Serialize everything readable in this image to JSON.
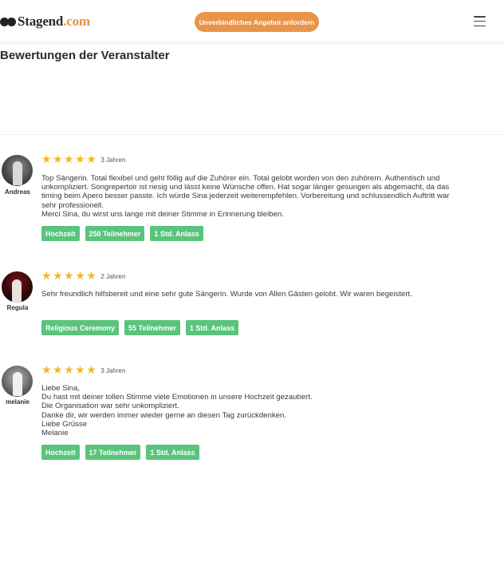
{
  "header": {
    "logo_main": "Stagend",
    "logo_suffix": ".com",
    "cta_label": "Unverbindliches Angebot anfordern"
  },
  "page": {
    "section_title": "Bewertungen der Veranstalter"
  },
  "colors": {
    "accent": "#e8954a",
    "star": "#f6b71a",
    "tag": "#5ac47c"
  },
  "reviews": [
    {
      "name": "Andreas",
      "rating": 5,
      "age": "3 Jahren",
      "lines": [
        "Top Sängerin. Total flexibel und geht föllig auf die Zuhörer ein. Total gelobt worden von den zuhörern. Authentisch und",
        "unkompliziert. Songrepertoir ist riesig und lässt keine Wünsche offen. Hat sogar länger gesungen als abgemacht, da das",
        "timing beim Apero besser passte. Ich würde Sina jederzeit weiterempfehlen. Vorbereitung und schlussendlich Auftritt war",
        "sehr professionell.",
        "Merci Sina, du wirst uns lange mit deiner Stimme in Erinnerung bleiben."
      ],
      "tags": [
        "Hochzeit",
        "250 Teilnehmer",
        "1 Std. Anlass"
      ]
    },
    {
      "name": "Regula",
      "rating": 5,
      "age": "2 Jahren",
      "lines": [
        "Sehr freundlich hilfsbereit und eine sehr gute Sängerin. Wurde von Allen Gästen gelobt. Wir waren begeistert."
      ],
      "tags": [
        "Religious Ceremony",
        "55 Teilnehmer",
        "1 Std. Anlass"
      ]
    },
    {
      "name": "melanie",
      "rating": 5,
      "age": "3 Jahren",
      "lines": [
        "Liebe Sina,",
        "Du hast mit deiner tollen Stimme viele Emotionen in unsere Hochzeit gezaubert.",
        "Die Organisation war sehr unkompliziert.",
        "Danke dir, wir werden immer wieder gerne an diesen Tag zurückdenken.",
        "Liebe Grüsse",
        "Melanie"
      ],
      "tags": [
        "Hochzeit",
        "17 Teilnehmer",
        "1 Std. Anlass"
      ]
    }
  ]
}
